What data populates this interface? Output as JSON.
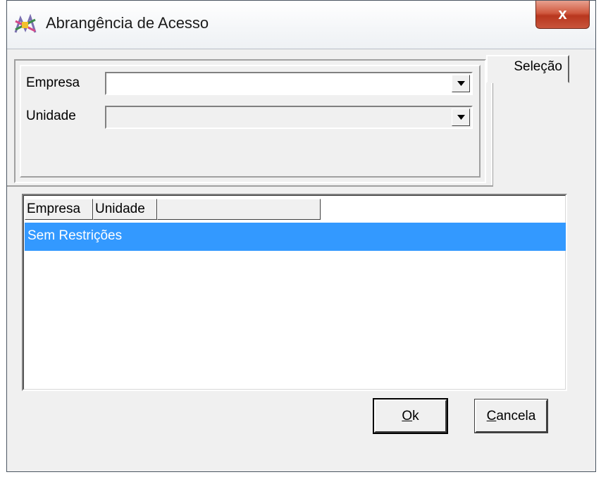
{
  "window": {
    "title": "Abrangência de Acesso",
    "close_label": "x"
  },
  "selection": {
    "tab_label": "Seleção",
    "empresa_label": "Empresa",
    "empresa_value": "",
    "unidade_label": "Unidade",
    "unidade_value": ""
  },
  "list": {
    "columns": [
      "Empresa",
      "Unidade",
      ""
    ],
    "rows": [
      {
        "text": "Sem Restrições",
        "selected": true
      }
    ]
  },
  "buttons": {
    "ok_mnemonic": "O",
    "ok_rest": "k",
    "cancel_mnemonic": "C",
    "cancel_rest": "ancela"
  },
  "colors": {
    "selection": "#3399ff",
    "close": "#c8553c"
  },
  "icons": {
    "app": "app-icon",
    "dropdown": "chevron-down-icon"
  }
}
